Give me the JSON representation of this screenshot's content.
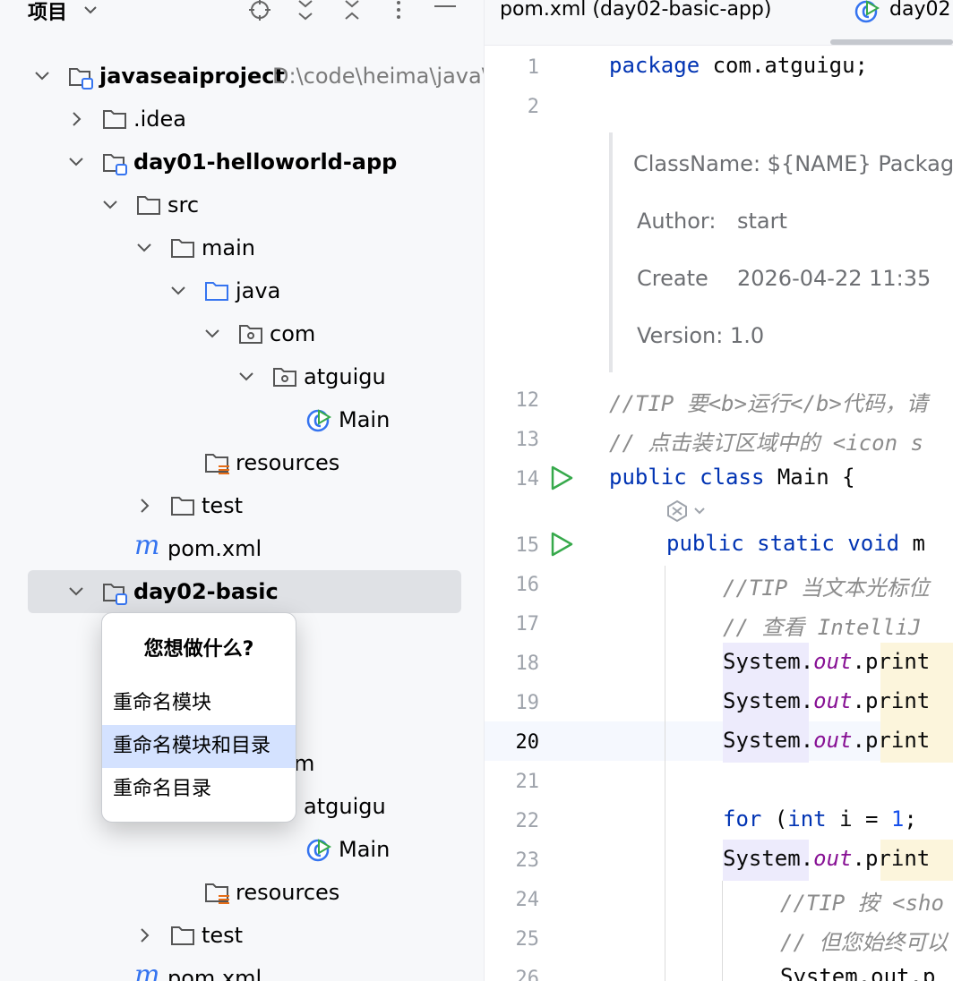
{
  "project_panel": {
    "title": "项目",
    "tree": [
      {
        "label": "javaseaiproject",
        "path": "D:\\code\\heima\\java\\j",
        "bold": true,
        "icon": "module-folder-icon",
        "expanded": true
      },
      {
        "label": ".idea",
        "icon": "folder-icon",
        "expanded": false
      },
      {
        "label": "day01-helloworld-app",
        "bold": true,
        "icon": "module-folder-icon",
        "expanded": true
      },
      {
        "label": "src",
        "icon": "folder-icon",
        "expanded": true
      },
      {
        "label": "main",
        "icon": "folder-icon",
        "expanded": true
      },
      {
        "label": "java",
        "icon": "source-folder-icon",
        "expanded": true
      },
      {
        "label": "com",
        "icon": "package-icon",
        "expanded": true
      },
      {
        "label": "atguigu",
        "icon": "package-icon",
        "expanded": true
      },
      {
        "label": "Main",
        "icon": "java-class-icon"
      },
      {
        "label": "resources",
        "icon": "resources-folder-icon"
      },
      {
        "label": "test",
        "icon": "folder-icon",
        "expanded": false
      },
      {
        "label": "pom.xml",
        "icon": "maven-icon"
      },
      {
        "label": "day02-basic",
        "bold": true,
        "icon": "module-folder-icon",
        "expanded": true,
        "selected": true
      },
      {
        "label": "m",
        "icon": "folder-icon"
      },
      {
        "label": "atguigu",
        "icon": "package-icon"
      },
      {
        "label": "Main",
        "icon": "java-class-icon"
      },
      {
        "label": "resources",
        "icon": "resources-folder-icon"
      },
      {
        "label": "test",
        "icon": "folder-icon",
        "expanded": false
      },
      {
        "label": "pom.xml",
        "icon": "maven-icon"
      }
    ]
  },
  "popup": {
    "title": "您想做什么?",
    "items": [
      "重命名模块",
      "重命名模块和目录",
      "重命名目录"
    ],
    "highlighted": "重命名模块和目录"
  },
  "tabs": [
    {
      "label": "pom.xml (day02-basic-app)"
    },
    {
      "label": "day02",
      "active": true
    }
  ],
  "editor": {
    "line_numbers": [
      "1",
      "2",
      "12",
      "13",
      "14",
      "15",
      "16",
      "17",
      "18",
      "19",
      "20",
      "21",
      "22",
      "23",
      "24",
      "25",
      "26"
    ],
    "doc_comment": {
      "classname": "ClassName: ${NAME} Packag",
      "author_key": "Author:",
      "author_val": "start",
      "create_key": "Create",
      "create_val": "2026-04-22 11:35",
      "version": "Version: 1.0"
    },
    "code": {
      "l1_kw": "package",
      "l1_rest": " com.atguigu;",
      "l12": "//TIP 要<b>运行</b>代码，请",
      "l13": "// 点击装订区域中的 <icon s",
      "l14_kw": "public class",
      "l14_rest": " Main {",
      "l15_kw": "public static void",
      "l15_rest": " m",
      "l16": "//TIP 当文本光标位",
      "l17": "// 查看 IntelliJ ",
      "sys": "System",
      "dot": ".",
      "out": "out",
      "print": ".print",
      "l22_for": "for",
      "l22_a": " (",
      "l22_int": "int",
      "l22_b": " i = ",
      "l22_num": "1",
      "l22_c": "; ",
      "l24": "//TIP 按 <sho",
      "l25": "// 但您始终可以",
      "l26": "System.out.p"
    },
    "current_line": "20"
  },
  "colors": {
    "keyword": "#0033b3",
    "comment": "#8c8c8c",
    "field": "#871094",
    "number": "#1750eb",
    "selection": "#dfe1e5",
    "popup_highlight": "#d4e2ff",
    "run_green": "#36a94b"
  }
}
